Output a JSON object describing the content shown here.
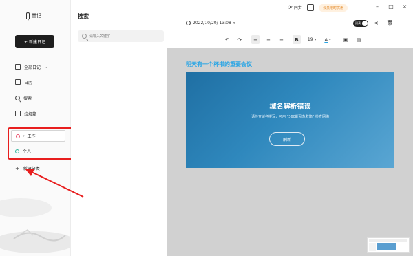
{
  "app": {
    "name": "墨记"
  },
  "sidebar": {
    "new_note_label": "+ 新建日记",
    "items": [
      {
        "label": "全部日记",
        "icon": "notebook-icon"
      },
      {
        "label": "日历",
        "icon": "calendar-icon"
      },
      {
        "label": "搜索",
        "icon": "search-icon"
      },
      {
        "label": "垃圾箱",
        "icon": "trash-icon"
      }
    ],
    "categories": [
      {
        "label": "工作",
        "color": "#e84d6a",
        "action": "···"
      },
      {
        "label": "个人",
        "color": "#2bb39a"
      }
    ],
    "add_category_label": "新建分类"
  },
  "list": {
    "title": "搜索",
    "search_placeholder": "请输入关键字"
  },
  "titlebar": {
    "sync_label": "同步",
    "vip_label": "会员限时优惠",
    "minimize": "–",
    "maximize": "□",
    "close": "×"
  },
  "editor": {
    "date": "2022/10/20/ 13:08",
    "read_toggle_label": "阅读",
    "font_size": "19",
    "bold_label": "B",
    "font_color_label": "A",
    "note_title": "明天有一个杯书的重要会议",
    "error": {
      "title": "域名解析错误",
      "description": "请检查域名拼写，可用 “360断网急救箱” 检查网络",
      "refresh_label": "刷新"
    }
  },
  "colors": {
    "annotation": "#e81e1e",
    "title_blue": "#29a5e5",
    "error_bg": "#2f88bd"
  }
}
